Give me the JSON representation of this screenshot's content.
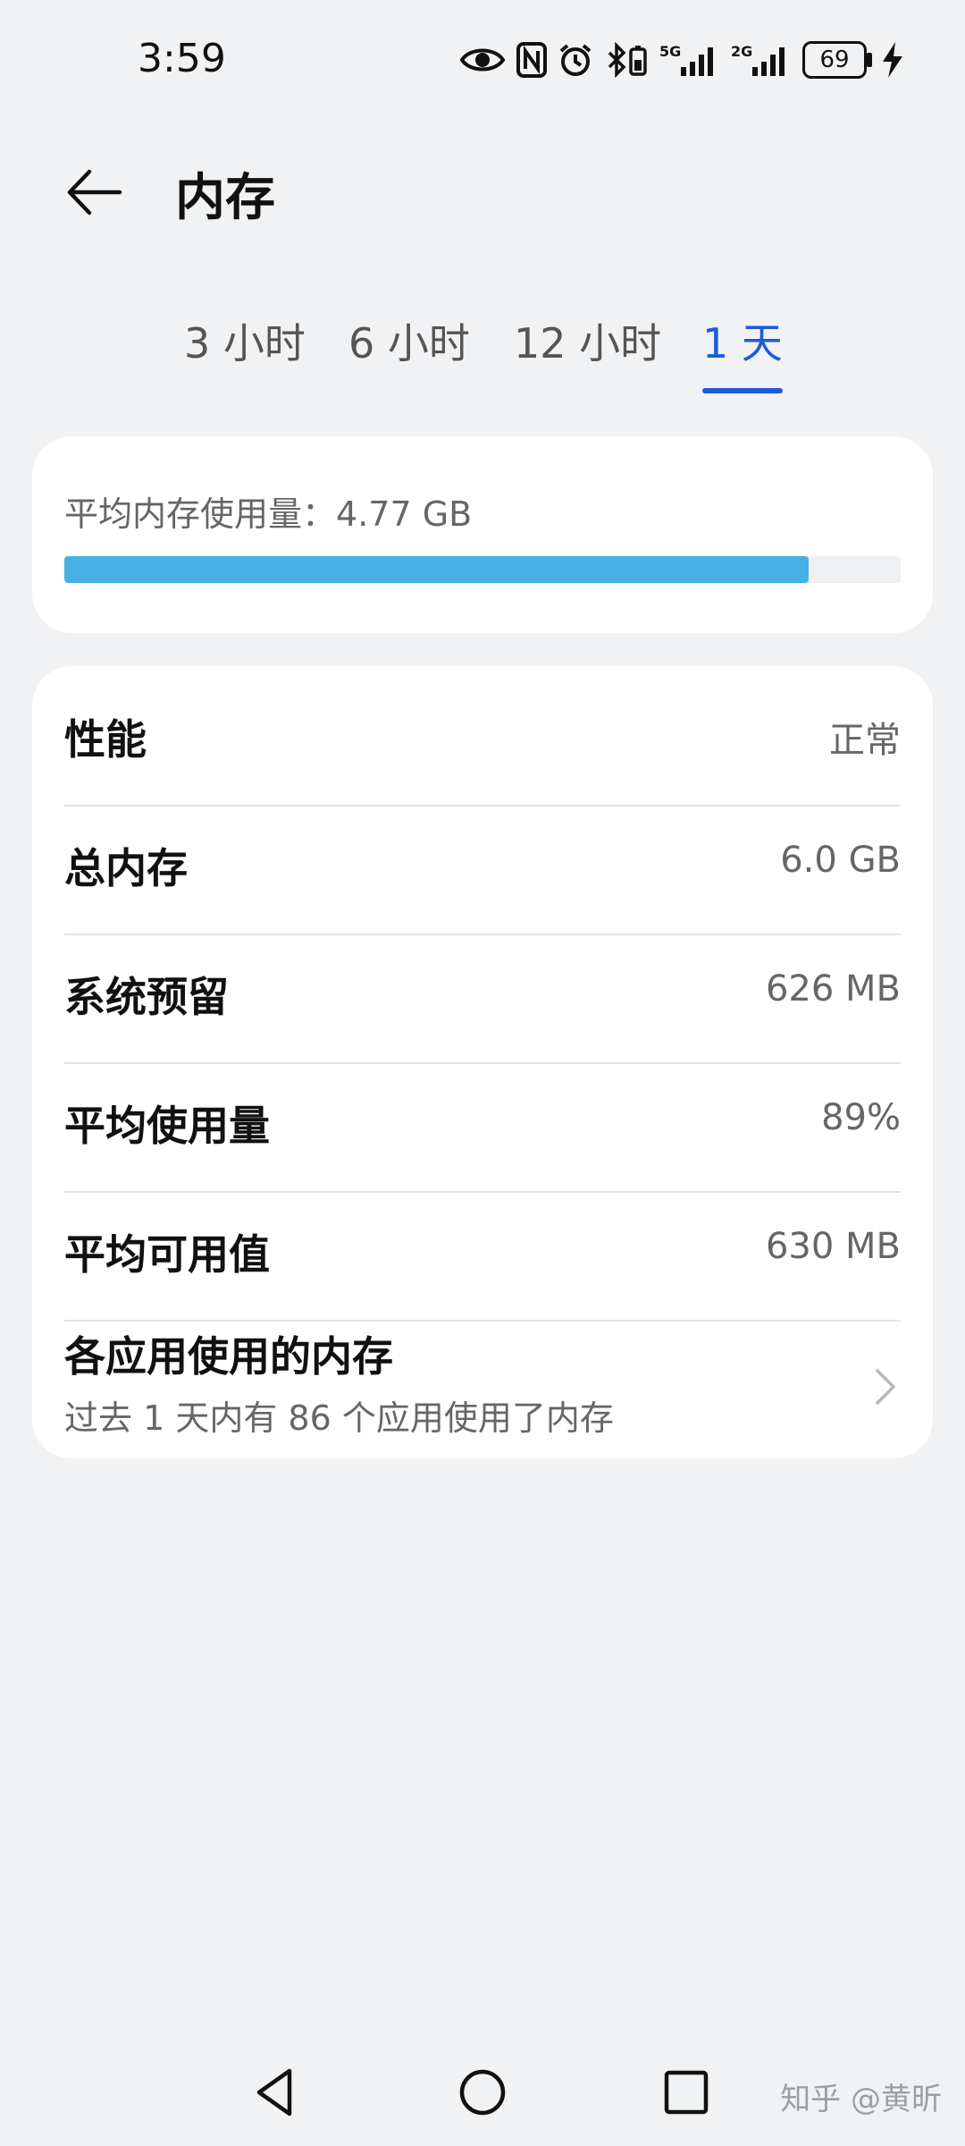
{
  "status_bar": {
    "time": "3:59",
    "network_1": "5G",
    "network_2": "2G",
    "battery": "69",
    "icons": [
      "eye-icon",
      "nfc-icon",
      "alarm-icon",
      "bluetooth-battery-icon",
      "signal-5g-icon",
      "signal-2g-icon",
      "battery-icon",
      "charging-icon"
    ]
  },
  "header": {
    "back_icon": "back-arrow-icon",
    "title": "内存"
  },
  "tabs": [
    {
      "label": "3 小时",
      "active": false
    },
    {
      "label": "6 小时",
      "active": false
    },
    {
      "label": "12 小时",
      "active": false
    },
    {
      "label": "1 天",
      "active": true
    }
  ],
  "summary": {
    "label": "平均内存使用量：",
    "value": "4.77 GB",
    "usage_fraction": 0.89,
    "bar_color": "#46b0e4"
  },
  "details": {
    "rows": [
      {
        "label": "性能",
        "value": "正常"
      },
      {
        "label": "总内存",
        "value": "6.0 GB"
      },
      {
        "label": "系统预留",
        "value": "626 MB"
      },
      {
        "label": "平均使用量",
        "value": "89%"
      },
      {
        "label": "平均可用值",
        "value": "630 MB"
      }
    ],
    "app_usage": {
      "title": "各应用使用的内存",
      "subtitle": "过去 1 天内有 86 个应用使用了内存"
    }
  },
  "nav_bar": {
    "buttons": [
      "back-triangle-icon",
      "home-circle-icon",
      "recents-square-icon"
    ]
  },
  "watermark": "知乎 @黄昕",
  "accent_color": "#1c5bd9"
}
